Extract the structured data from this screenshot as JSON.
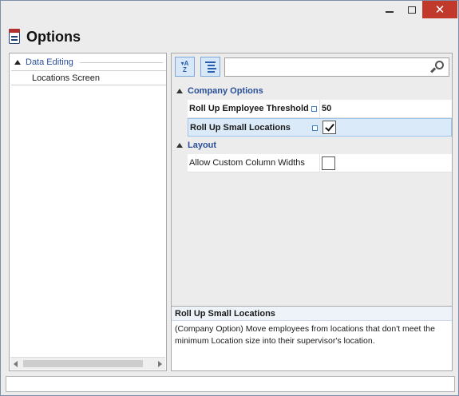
{
  "window": {
    "title": "Options",
    "controls": {
      "minimize": "minimize",
      "maximize": "maximize",
      "close": "✕"
    }
  },
  "tree": {
    "group_label": "Data Editing",
    "items": [
      {
        "label": "Locations Screen"
      }
    ]
  },
  "toolbar": {
    "sort_icon": "sort-alphabetical-icon",
    "categorize_icon": "categorize-icon",
    "search_value": "",
    "search_placeholder": ""
  },
  "categories": [
    {
      "label": "Company Options",
      "properties": [
        {
          "name": "Roll Up Employee Threshold",
          "value": "50",
          "type": "number",
          "bold": true,
          "modified": true
        },
        {
          "name": "Roll Up Small Locations",
          "value": "checked",
          "type": "checkbox",
          "bold": true,
          "modified": true,
          "selected": true
        }
      ]
    },
    {
      "label": "Layout",
      "properties": [
        {
          "name": "Allow Custom Column Widths",
          "value": "unchecked",
          "type": "checkbox",
          "bold": false,
          "modified": false
        }
      ]
    }
  ],
  "description": {
    "title": "Roll Up Small Locations",
    "text": "(Company Option)  Move employees from locations that don't meet the minimum Location size into their supervisor's location."
  },
  "colors": {
    "close_button": "#c0392b",
    "accent_blue": "#2a4f9a",
    "selected_row": "#dbeaf8"
  }
}
